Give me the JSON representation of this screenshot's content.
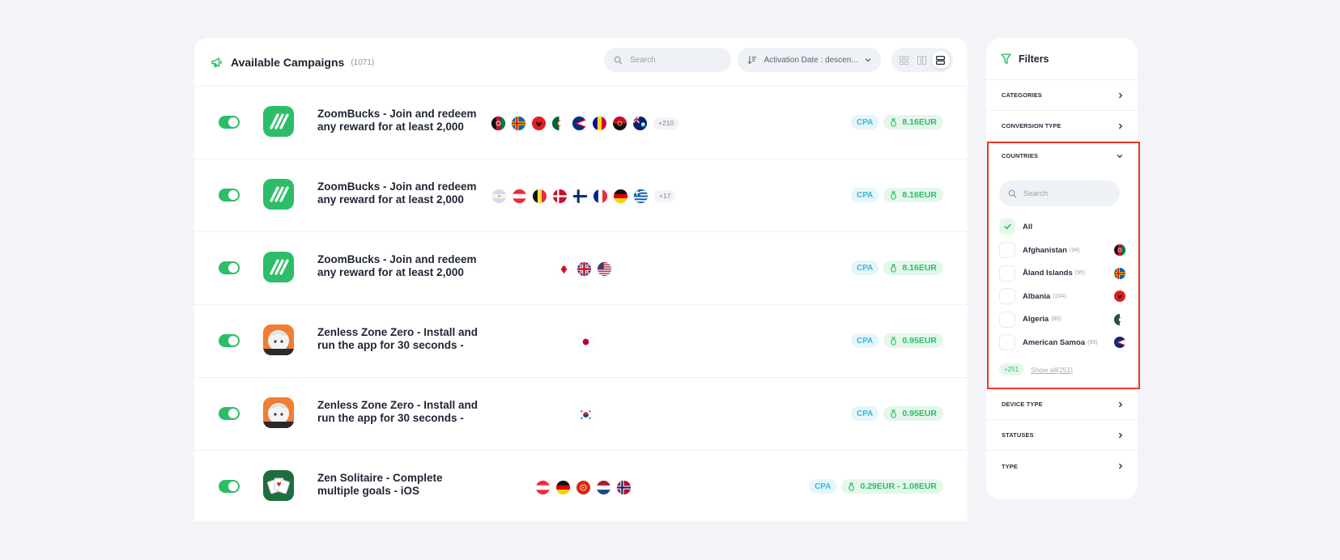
{
  "header": {
    "title": "Available Campaigns",
    "count": "(1071)",
    "search_placeholder": "Search",
    "sort_label": "Activation Date : descen..."
  },
  "colors": {
    "brand_green": "#2dbd68",
    "cpa_blue": "#3fb6d3",
    "highlight_red": "#e43a22"
  },
  "campaigns": [
    {
      "title": "ZoomBucks - Join and redeem any reward for at least 2,000",
      "icon": "zoombucks-logo",
      "flags": [
        "afghanistan",
        "aland-islands",
        "albania",
        "algeria",
        "american-samoa",
        "andorra",
        "angola",
        "anguilla"
      ],
      "more": "+210",
      "type": "CPA",
      "payout": "8.16EUR"
    },
    {
      "title": "ZoomBucks - Join and redeem any reward for at least 2,000",
      "icon": "zoombucks-logo",
      "flags": [
        "argentina",
        "austria",
        "belgium",
        "denmark",
        "finland",
        "france",
        "germany",
        "greece"
      ],
      "more": "+17",
      "type": "CPA",
      "payout": "8.16EUR"
    },
    {
      "title": "ZoomBucks - Join and redeem any reward for at least 2,000",
      "icon": "zoombucks-logo",
      "flags": [
        "canada",
        "united-kingdom",
        "united-states"
      ],
      "more": "",
      "type": "CPA",
      "payout": "8.16EUR"
    },
    {
      "title": "Zenless Zone Zero - Install and run the app for 30 seconds -",
      "icon": "zenless-zone-zero-logo",
      "flags": [
        "japan"
      ],
      "more": "",
      "type": "CPA",
      "payout": "0.95EUR"
    },
    {
      "title": "Zenless Zone Zero - Install and run the app for 30 seconds -",
      "icon": "zenless-zone-zero-logo",
      "flags": [
        "south-korea"
      ],
      "more": "",
      "type": "CPA",
      "payout": "0.95EUR"
    },
    {
      "title": "Zen Solitaire - Complete multiple goals - iOS",
      "icon": "zen-solitaire-logo",
      "flags": [
        "austria",
        "germany",
        "hong-kong",
        "netherlands",
        "norway"
      ],
      "more": "",
      "type": "CPA",
      "payout": "0.29EUR - 1.08EUR"
    }
  ],
  "filters": {
    "title": "Filters",
    "sections": {
      "categories": "CATEGORIES",
      "conversion_type": "CONVERSION TYPE",
      "countries": "COUNTRIES",
      "device_type": "DEVICE TYPE",
      "statuses": "STATUSES",
      "type": "TYPE"
    },
    "countries": {
      "search_placeholder": "Search",
      "all_label": "All",
      "all_checked": true,
      "items": [
        {
          "name": "Afghanistan",
          "count": "(94)",
          "flag": "afghanistan"
        },
        {
          "name": "Åland Islands",
          "count": "(95)",
          "flag": "aland-islands"
        },
        {
          "name": "Albania",
          "count": "(104)",
          "flag": "albania"
        },
        {
          "name": "Algeria",
          "count": "(80)",
          "flag": "algeria"
        },
        {
          "name": "American Samoa",
          "count": "(99)",
          "flag": "american-samoa"
        }
      ],
      "more": "+251",
      "show_all": "Show all(251)"
    }
  }
}
